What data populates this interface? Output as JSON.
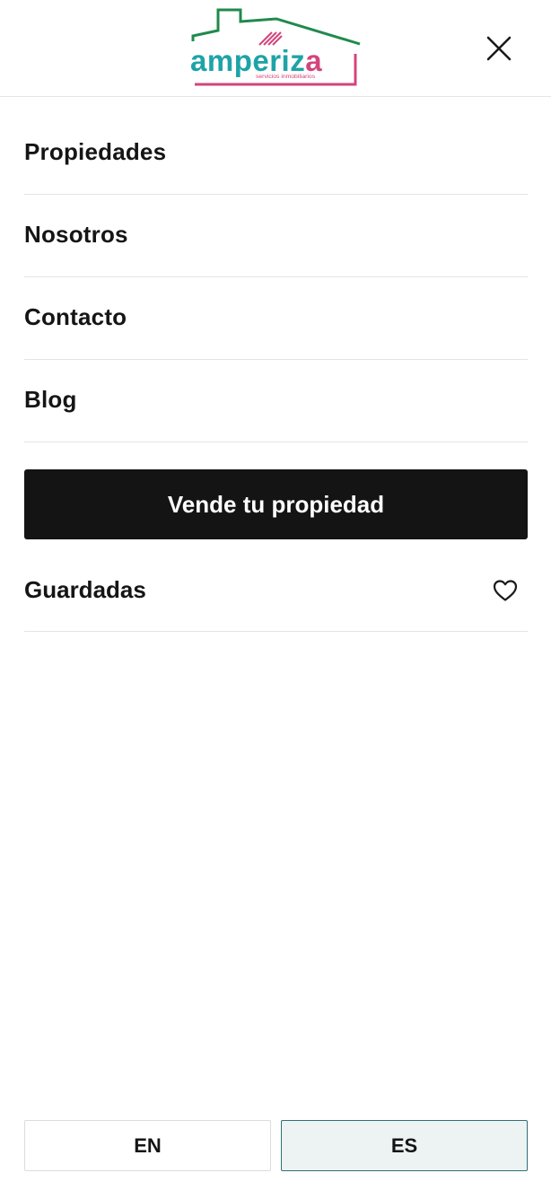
{
  "header": {
    "logo": {
      "name": "amperiza",
      "tagline": "servicios inmobiliarios",
      "colors": {
        "roof": "#1f8a4c",
        "wordmark": "#1ea3a7",
        "accent": "#d4447c"
      }
    },
    "close_icon": "close-icon"
  },
  "menu": {
    "items": [
      {
        "label": "Propiedades"
      },
      {
        "label": "Nosotros"
      },
      {
        "label": "Contacto"
      },
      {
        "label": "Blog"
      }
    ],
    "cta_label": "Vende tu propiedad",
    "saved_label": "Guardadas",
    "saved_icon": "heart-icon"
  },
  "languages": {
    "options": [
      {
        "label": "EN",
        "active": false
      },
      {
        "label": "ES",
        "active": true
      }
    ]
  },
  "colors": {
    "cta_background": "#141414",
    "active_lang_border": "#2e6f79",
    "active_lang_background": "#edf3f3"
  }
}
